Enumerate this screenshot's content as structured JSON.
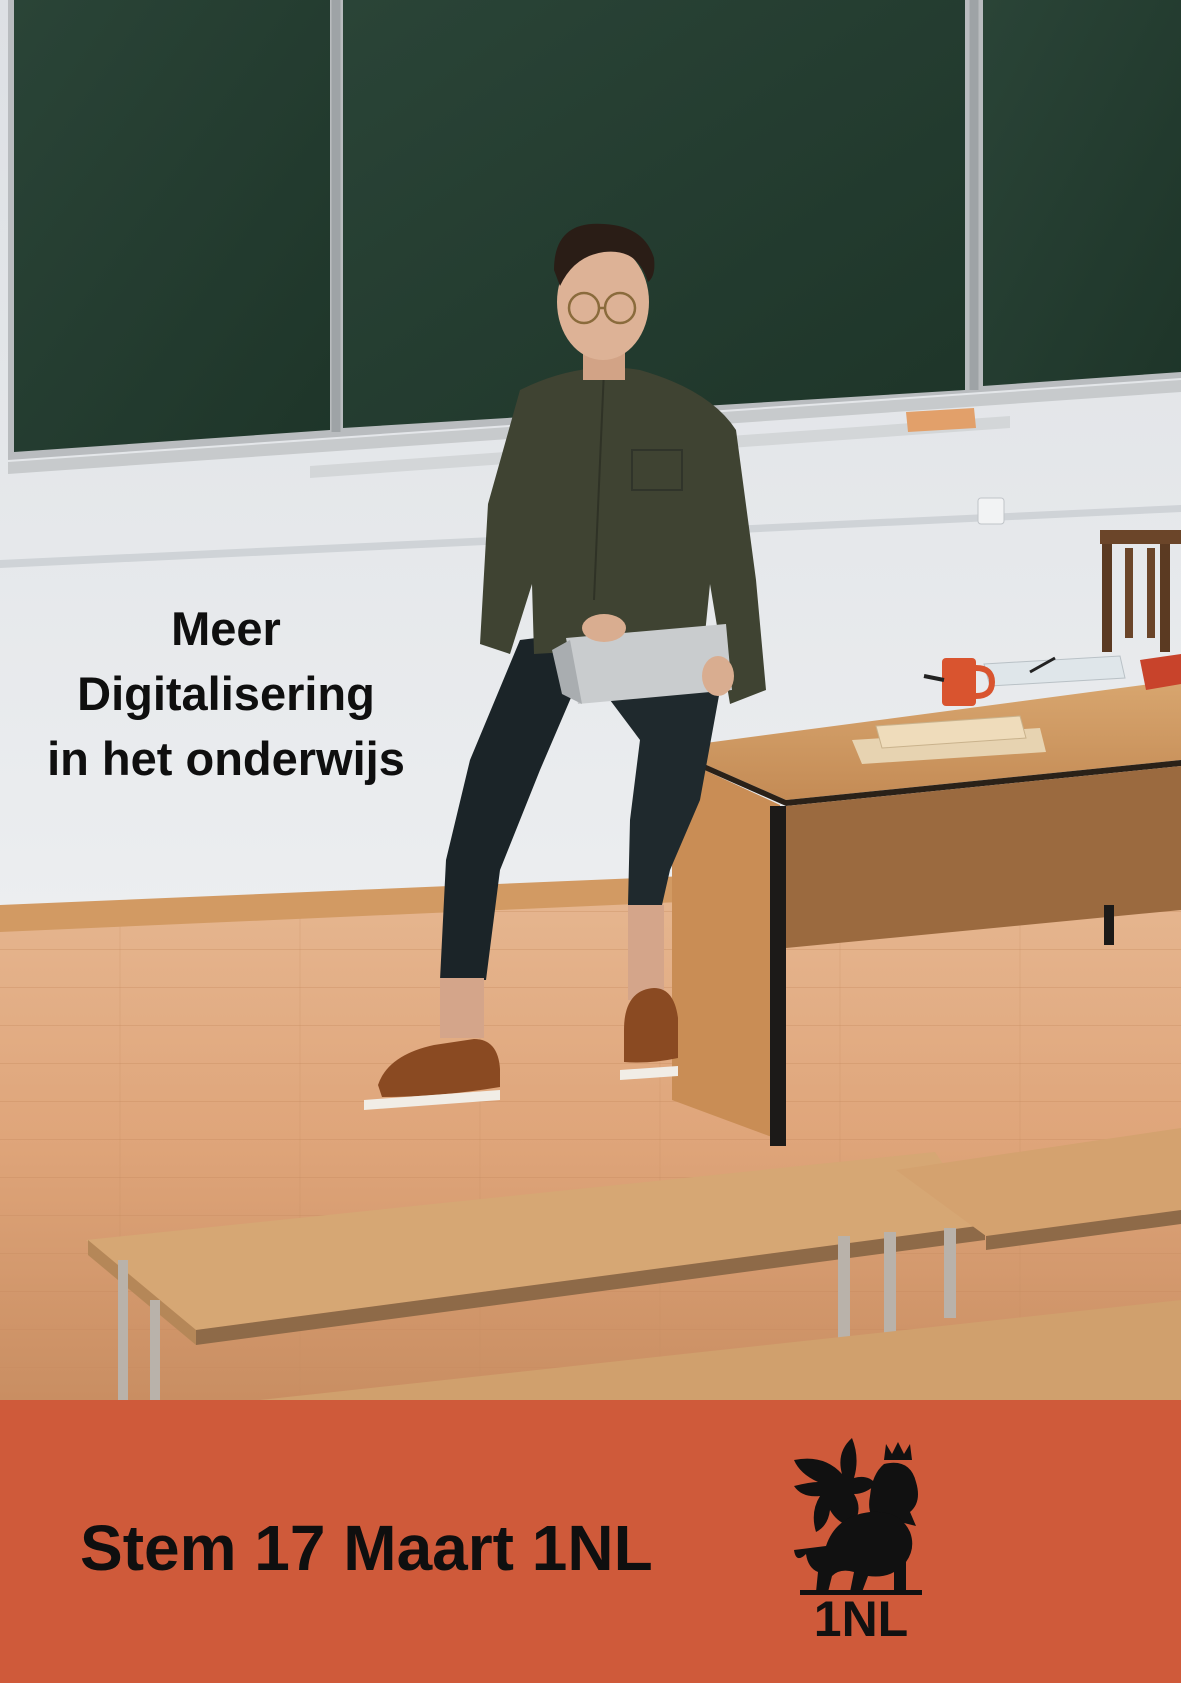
{
  "poster": {
    "headline": [
      "Meer",
      "Digitalisering",
      "in het onderwijs"
    ],
    "cta": "Stem 17 Maart 1NL"
  },
  "logo": {
    "icon": "winged-lion-crown-icon",
    "text": "1NL"
  },
  "colors": {
    "banner": "#cf5a3a",
    "chalkboard": "#233b30",
    "wall": "#e6e8eb",
    "floor": "#d9a479",
    "desk": "#c58b56",
    "text": "#0f0f0f"
  }
}
